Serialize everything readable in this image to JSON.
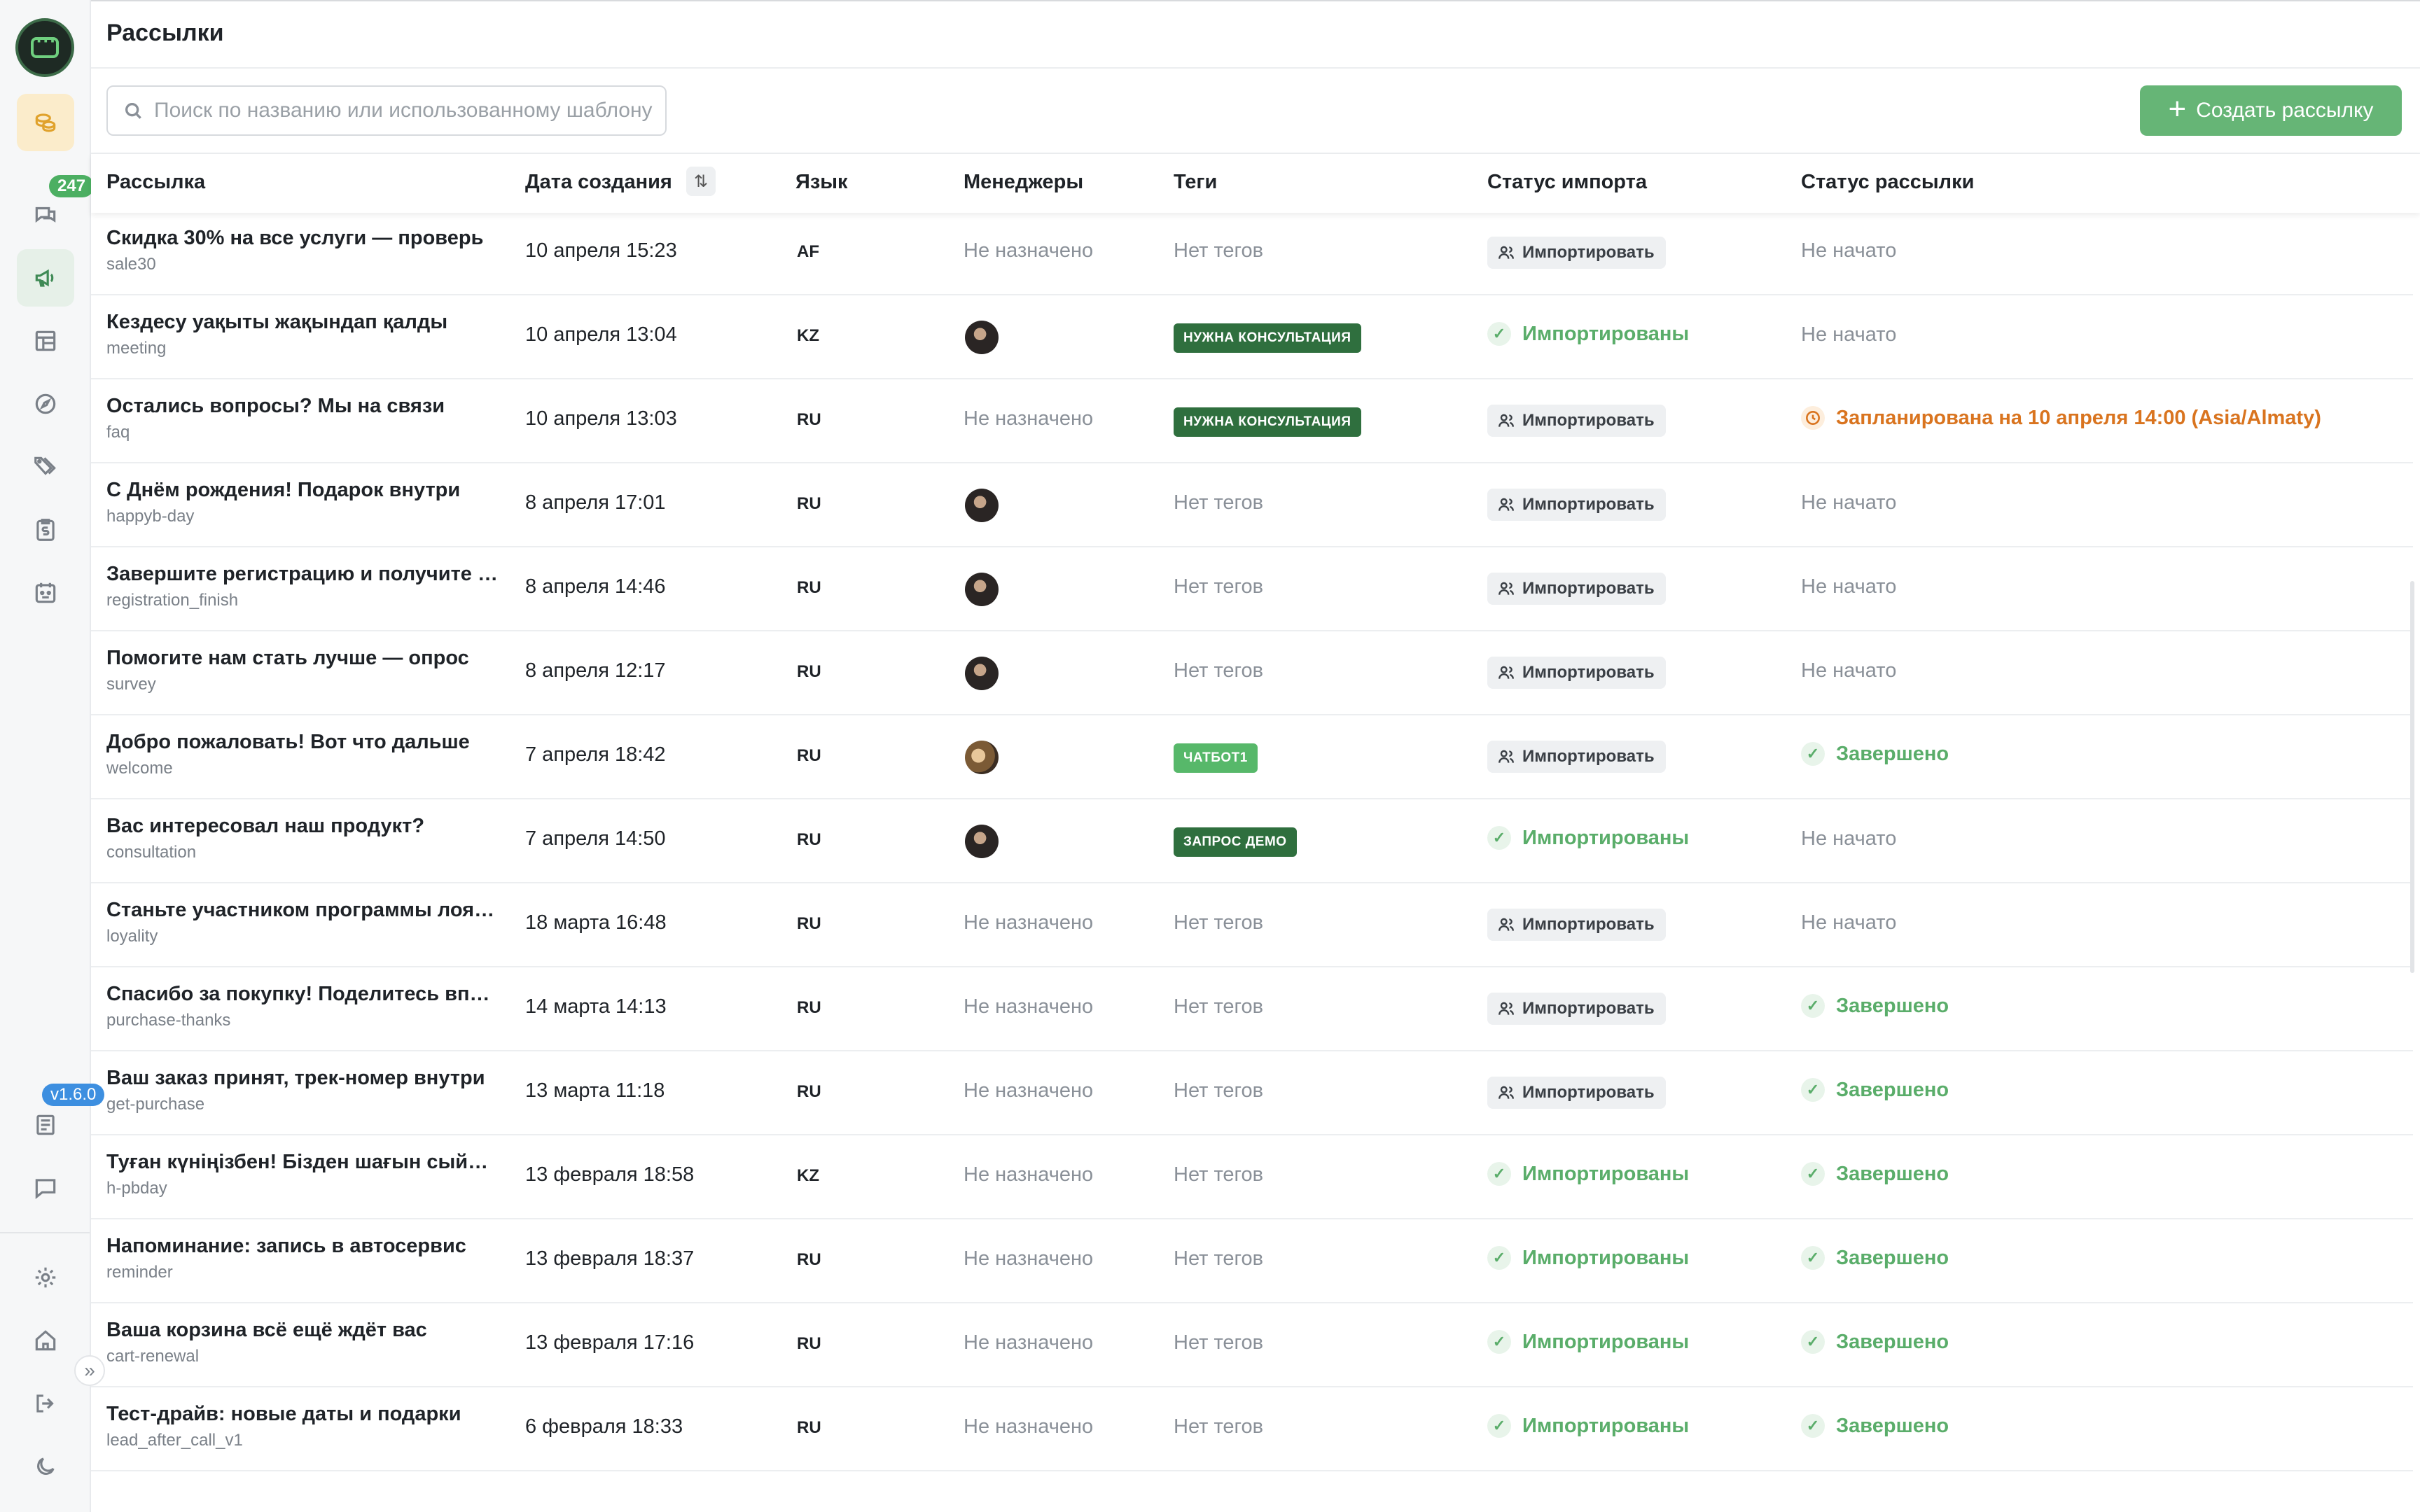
{
  "header": {
    "title": "Рассылки"
  },
  "search": {
    "placeholder": "Поиск по названию или использованному шаблону"
  },
  "toolbar": {
    "create_label": "Создать рассылку",
    "create_icon": "plus-icon"
  },
  "sidebar": {
    "chat_badge": "247",
    "version": "v1.6.0"
  },
  "columns": {
    "name": "Рассылка",
    "date": "Дата создания",
    "lang": "Язык",
    "managers": "Менеджеры",
    "tags": "Теги",
    "import_status": "Статус импорта",
    "send_status": "Статус рассылки"
  },
  "rows": [
    {
      "title": "Скидка 30% на все услуги — проверь",
      "slug": "sale30",
      "date": "10 апреля 15:23",
      "lang": "AF",
      "manager": "Не назначено",
      "tag": "Нет тегов",
      "import": "Импортировать",
      "status": "Не начато"
    },
    {
      "title": "Кездесу уақыты жақындап қалды",
      "slug": "meeting",
      "date": "10 апреля 13:04",
      "lang": "KZ",
      "manager": "",
      "tag": "НУЖНА КОНСУЛЬТАЦИЯ",
      "import": "Импортированы",
      "status": "Не начато"
    },
    {
      "title": "Остались вопросы? Мы на связи",
      "slug": "faq",
      "date": "10 апреля 13:03",
      "lang": "RU",
      "manager": "Не назначено",
      "tag": "НУЖНА КОНСУЛЬТАЦИЯ",
      "import": "Импортировать",
      "status": "Запланирована на 10 апреля 14:00 (Asia/Almaty)"
    },
    {
      "title": "С Днём рождения! Подарок внутри",
      "slug": "happyb-day",
      "date": "8 апреля 17:01",
      "lang": "RU",
      "manager": "",
      "tag": "Нет тегов",
      "import": "Импортировать",
      "status": "Не начато"
    },
    {
      "title": "Завершите регистрацию и получите …",
      "slug": "registration_finish",
      "date": "8 апреля 14:46",
      "lang": "RU",
      "manager": "",
      "tag": "Нет тегов",
      "import": "Импортировать",
      "status": "Не начато"
    },
    {
      "title": "Помогите нам стать лучше — опрос",
      "slug": "survey",
      "date": "8 апреля 12:17",
      "lang": "RU",
      "manager": "",
      "tag": "Нет тегов",
      "import": "Импортировать",
      "status": "Не начато"
    },
    {
      "title": "Добро пожаловать! Вот что дальше",
      "slug": "welcome",
      "date": "7 апреля 18:42",
      "lang": "RU",
      "manager": "",
      "tag": "ЧАТБОТ1",
      "import": "Импортировать",
      "status": "Завершено"
    },
    {
      "title": "Вас интересовал наш продукт?",
      "slug": "consultation",
      "date": "7 апреля 14:50",
      "lang": "RU",
      "manager": "",
      "tag": "ЗАПРОС ДЕМО",
      "import": "Импортированы",
      "status": "Не начато"
    },
    {
      "title": "Станьте участником программы лоя…",
      "slug": "loyality",
      "date": "18 марта 16:48",
      "lang": "RU",
      "manager": "Не назначено",
      "tag": "Нет тегов",
      "import": "Импортировать",
      "status": "Не начато"
    },
    {
      "title": "Спасибо за покупку! Поделитесь впе…",
      "slug": "purchase-thanks",
      "date": "14 марта 14:13",
      "lang": "RU",
      "manager": "Не назначено",
      "tag": "Нет тегов",
      "import": "Импортировать",
      "status": "Завершено"
    },
    {
      "title": "Ваш заказ принят, трек-номер внутри",
      "slug": "get-purchase",
      "date": "13 марта 11:18",
      "lang": "RU",
      "manager": "Не назначено",
      "tag": "Нет тегов",
      "import": "Импортировать",
      "status": "Завершено"
    },
    {
      "title": "Туған күніңізбен! Бізден шағын сыйл…",
      "slug": "h-pbday",
      "date": "13 февраля 18:58",
      "lang": "KZ",
      "manager": "Не назначено",
      "tag": "Нет тегов",
      "import": "Импортированы",
      "status": "Завершено"
    },
    {
      "title": "Напоминание: запись в автосервис",
      "slug": "reminder",
      "date": "13 февраля 18:37",
      "lang": "RU",
      "manager": "Не назначено",
      "tag": "Нет тегов",
      "import": "Импортированы",
      "status": "Завершено"
    },
    {
      "title": "Ваша корзина всё ещё ждёт вас",
      "slug": "cart-renewal",
      "date": "13 февраля 17:16",
      "lang": "RU",
      "manager": "Не назначено",
      "tag": "Нет тегов",
      "import": "Импортированы",
      "status": "Завершено"
    },
    {
      "title": "Тест-драйв: новые даты и подарки",
      "slug": "lead_after_call_v1",
      "date": "6 февраля 18:33",
      "lang": "RU",
      "manager": "Не назначено",
      "tag": "Нет тегов",
      "import": "Импортированы",
      "status": "Завершено"
    }
  ],
  "colors": {
    "accent_green": "#66b576",
    "done_green": "#5aad6a",
    "scheduled_orange": "#d9741f",
    "tag_dark": "#2f6f3e"
  }
}
